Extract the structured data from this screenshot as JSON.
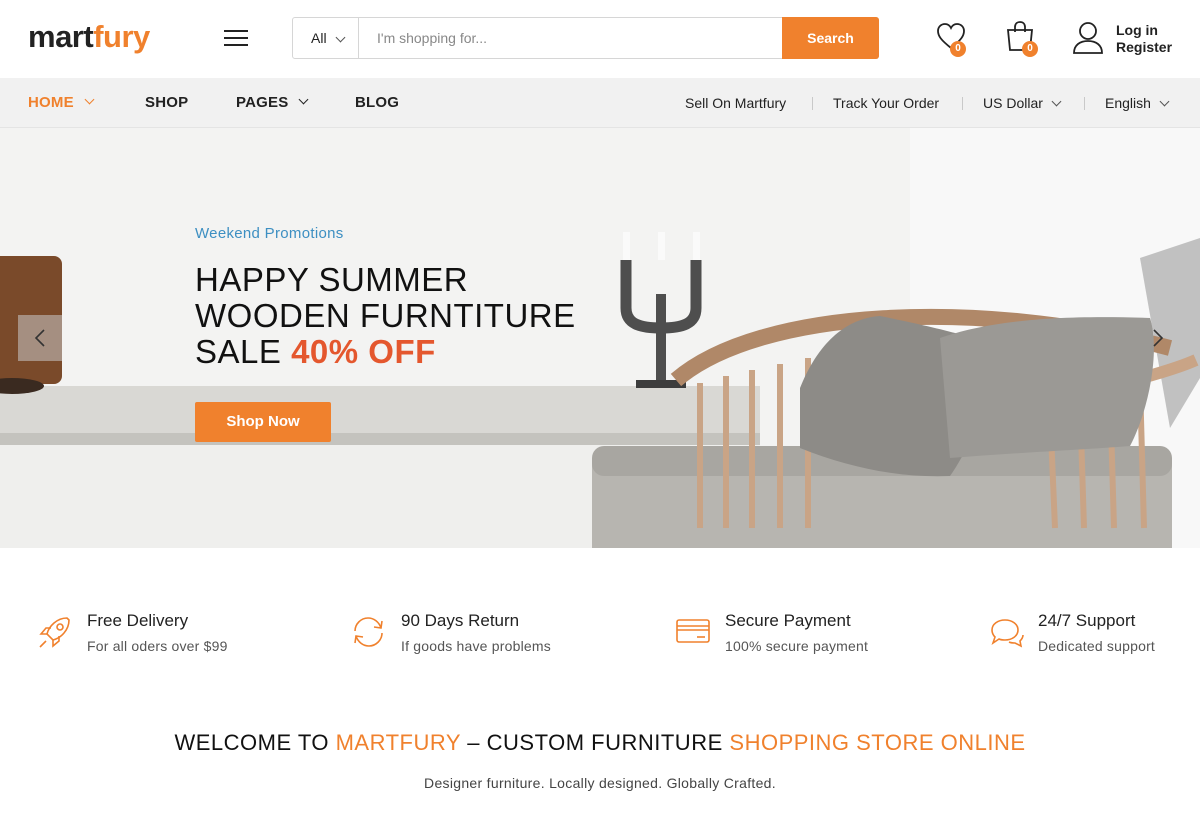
{
  "brand": {
    "logo_part1": "mart",
    "logo_part2": "fury"
  },
  "search": {
    "category": "All",
    "placeholder": "I'm shopping for...",
    "button": "Search"
  },
  "header": {
    "wishlist_count": "0",
    "cart_count": "0",
    "login": "Log in",
    "register": "Register"
  },
  "nav": {
    "left": [
      "HOME",
      "SHOP",
      "PAGES",
      "BLOG"
    ],
    "right": [
      "Sell On Martfury",
      "Track Your Order",
      "US Dollar",
      "English"
    ]
  },
  "hero": {
    "promo": "Weekend Promotions",
    "line1": "HAPPY SUMMER",
    "line2": "WOODEN FURNTITURE",
    "line3_prefix": "SALE",
    "line3_highlight": "40% OFF",
    "cta": "Shop Now"
  },
  "features": [
    {
      "title": "Free Delivery",
      "subtitle": "For all oders over $99",
      "icon": "rocket-icon"
    },
    {
      "title": "90 Days Return",
      "subtitle": "If goods have problems",
      "icon": "refresh-icon"
    },
    {
      "title": "Secure Payment",
      "subtitle": "100% secure payment",
      "icon": "credit-card-icon"
    },
    {
      "title": "24/7 Support",
      "subtitle": "Dedicated support",
      "icon": "chat-icon"
    }
  ],
  "welcome": {
    "part1": "WELCOME TO",
    "brand": "MARTFURY",
    "part2": "– CUSTOM FURNITURE",
    "part3": "SHOPPING STORE ONLINE",
    "tagline": "Designer furniture. Locally designed. Globally Crafted."
  },
  "colors": {
    "accent": "#f0812d",
    "sale": "#e4572e",
    "promo": "#3d8fc2"
  }
}
